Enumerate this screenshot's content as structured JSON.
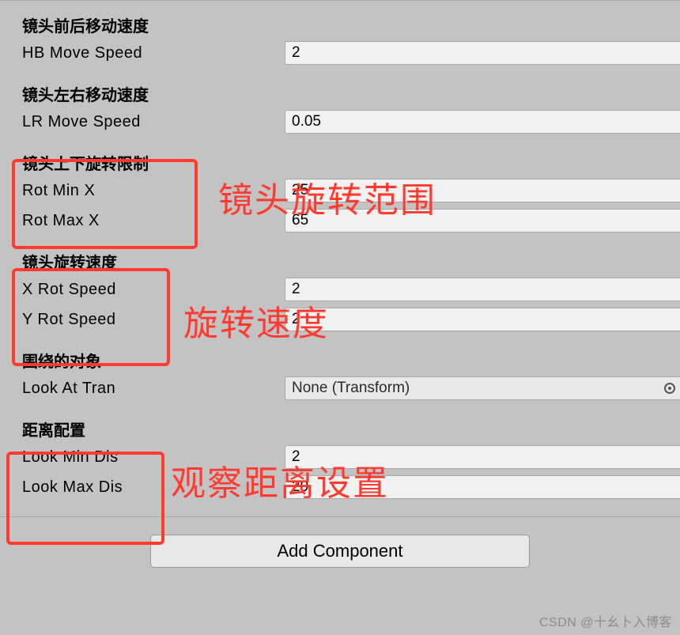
{
  "groups": {
    "hb": {
      "header": "镜头前后移动速度",
      "field_label": "HB Move Speed",
      "value": "2"
    },
    "lr": {
      "header": "镜头左右移动速度",
      "field_label": "LR Move Speed",
      "value": "0.05"
    },
    "rot_limit": {
      "header": "镜头上下旋转限制",
      "min_label": "Rot Min X",
      "min_value": "25",
      "max_label": "Rot Max X",
      "max_value": "65"
    },
    "rot_speed": {
      "header": "镜头旋转速度",
      "x_label": "X Rot Speed",
      "x_value": "2",
      "y_label": "Y Rot Speed",
      "y_value": "2"
    },
    "look_at": {
      "header": "围绕的对象",
      "field_label": "Look At Tran",
      "value": "None (Transform)"
    },
    "distance": {
      "header": "距离配置",
      "min_label": "Look Min Dis",
      "min_value": "2",
      "max_label": "Look Max Dis",
      "max_value": "20"
    }
  },
  "add_component_label": "Add Component",
  "annotations": {
    "rot_range": "镜头旋转范围",
    "rot_speed": "旋转速度",
    "distance": "观察距离设置"
  },
  "watermark": "CSDN @十幺卜入博客"
}
